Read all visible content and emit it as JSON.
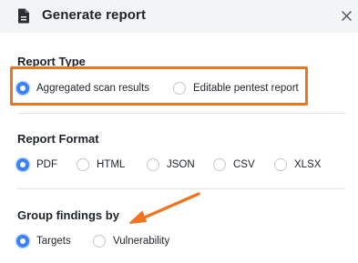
{
  "header": {
    "title": "Generate report",
    "doc_icon": "document-icon",
    "close_icon": "close-icon"
  },
  "report_type": {
    "title": "Report Type",
    "selected": "Aggregated scan results",
    "options": [
      "Aggregated scan results",
      "Editable pentest report"
    ]
  },
  "report_format": {
    "title": "Report Format",
    "selected": "PDF",
    "options": [
      "PDF",
      "HTML",
      "JSON",
      "CSV",
      "XLSX"
    ]
  },
  "group_findings": {
    "title": "Group findings by",
    "selected": "Targets",
    "options": [
      "Targets",
      "Vulnerability"
    ]
  },
  "annotations": {
    "highlight_color": "#f0741f",
    "arrow_icon": "orange-arrow-icon"
  },
  "colors": {
    "accent": "#3b82f6",
    "header_bg": "#f3f4f6"
  }
}
